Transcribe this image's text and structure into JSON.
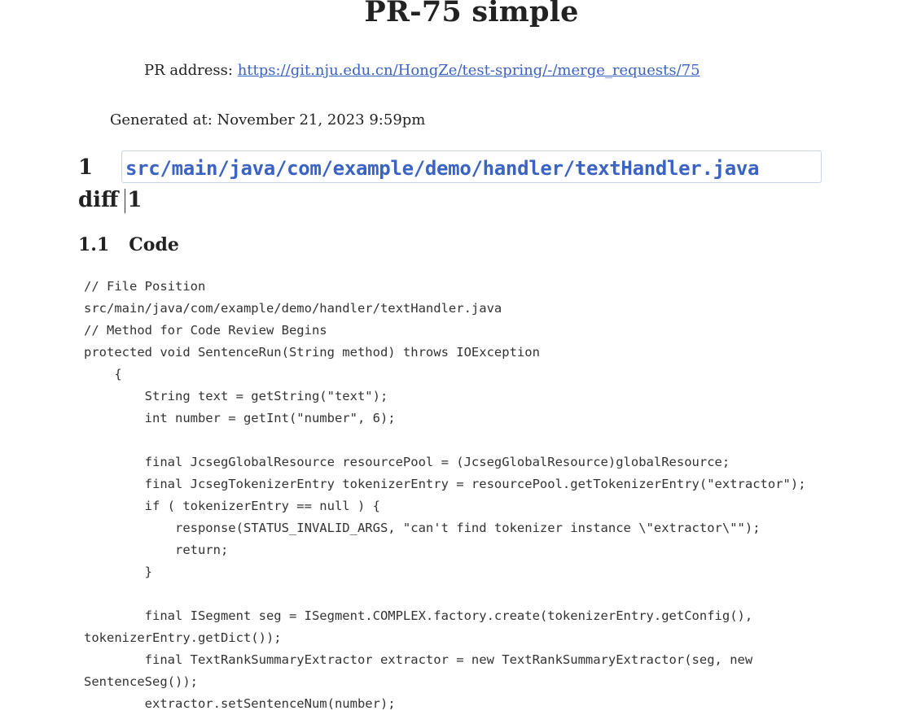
{
  "document": {
    "title": "PR-75 simple",
    "pr_address_label": "PR address: ",
    "pr_address_url": "https://git.nju.edu.cn/HongZe/test-spring/-/merge_requests/75",
    "generated_at": "Generated at: November 21, 2023 9:59pm",
    "link_color": "#3b63c4"
  },
  "section": {
    "number": "1",
    "file_path": "src/main/java/com/example/demo/handler/textHandler.java",
    "diff_label": "diff",
    "diff_number": "1"
  },
  "subsection": {
    "number": "1.1",
    "title": "Code"
  },
  "code_lines": [
    "// File Position",
    "src/main/java/com/example/demo/handler/textHandler.java",
    "// Method for Code Review Begins",
    "protected void SentenceRun(String method) throws IOException",
    "    {",
    "        String text = getString(\"text\");",
    "        int number = getInt(\"number\", 6);",
    "",
    "        final JcsegGlobalResource resourcePool = (JcsegGlobalResource)globalResource;",
    "        final JcsegTokenizerEntry tokenizerEntry = resourcePool.getTokenizerEntry(\"extractor\");",
    "        if ( tokenizerEntry == null ) {",
    "            response(STATUS_INVALID_ARGS, \"can't find tokenizer instance \\\"extractor\\\"\");",
    "            return;",
    "        }",
    "",
    "        final ISegment seg = ISegment.COMPLEX.factory.create(tokenizerEntry.getConfig(),",
    "tokenizerEntry.getDict());",
    "        final TextRankSummaryExtractor extractor = new TextRankSummaryExtractor(seg, new",
    "SentenceSeg());",
    "        extractor.setSentenceNum(number);"
  ]
}
